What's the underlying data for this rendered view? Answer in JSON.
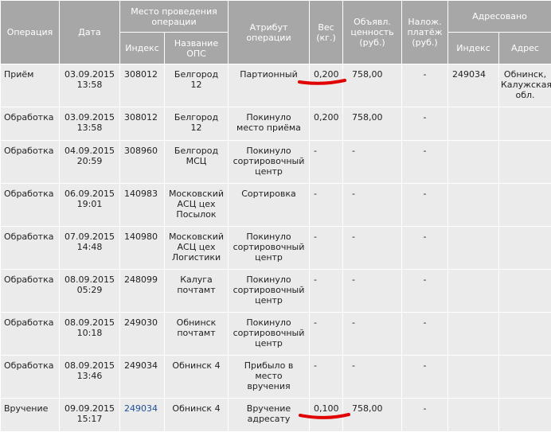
{
  "headers": {
    "operation": "Операция",
    "date": "Дата",
    "place_group": "Место проведения операции",
    "index": "Индекс",
    "ops_name": "Название ОПС",
    "attribute": "Атрибут операции",
    "weight": "Вес (кг.)",
    "declared": "Объявл. ценность (руб.)",
    "cod": "Налож. платёж (руб.)",
    "addressed": "Адресовано",
    "addr_index": "Индекс",
    "address": "Адрес"
  },
  "rows": [
    {
      "op": "Приём",
      "date": "03.09.2015\n13:58",
      "index": "308012",
      "name": "Белгород\n12",
      "attr": "Партионный",
      "weight": "0,200",
      "declared": "758,00",
      "cod": "-",
      "addr_index": "249034",
      "address": "Обнинск,\nКалужская\nобл."
    },
    {
      "op": "Обработка",
      "date": "03.09.2015\n13:58",
      "index": "308012",
      "name": "Белгород\n12",
      "attr": "Покинуло\nместо приёма",
      "weight": "0,200",
      "declared": "758,00",
      "cod": "-",
      "addr_index": "",
      "address": ""
    },
    {
      "op": "Обработка",
      "date": "04.09.2015\n20:59",
      "index": "308960",
      "name": "Белгород\nМСЦ",
      "attr": "Покинуло\nсортировочный\nцентр",
      "weight": "-",
      "declared": "-",
      "cod": "-",
      "addr_index": "",
      "address": ""
    },
    {
      "op": "Обработка",
      "date": "06.09.2015\n19:01",
      "index": "140983",
      "name": "Московский\nАСЦ цех\nПосылок",
      "attr": "Сортировка",
      "weight": "-",
      "declared": "-",
      "cod": "-",
      "addr_index": "",
      "address": ""
    },
    {
      "op": "Обработка",
      "date": "07.09.2015\n14:48",
      "index": "140980",
      "name": "Московский\nАСЦ цех\nЛогистики",
      "attr": "Покинуло\nсортировочный\nцентр",
      "weight": "-",
      "declared": "-",
      "cod": "-",
      "addr_index": "",
      "address": ""
    },
    {
      "op": "Обработка",
      "date": "08.09.2015\n05:29",
      "index": "248099",
      "name": "Калуга\nпочтамт",
      "attr": "Покинуло\nсортировочный\nцентр",
      "weight": "-",
      "declared": "-",
      "cod": "-",
      "addr_index": "",
      "address": ""
    },
    {
      "op": "Обработка",
      "date": "08.09.2015\n10:18",
      "index": "249030",
      "name": "Обнинск\nпочтамт",
      "attr": "Покинуло\nсортировочный\nцентр",
      "weight": "-",
      "declared": "-",
      "cod": "-",
      "addr_index": "",
      "address": ""
    },
    {
      "op": "Обработка",
      "date": "08.09.2015\n13:46",
      "index": "249034",
      "name": "Обнинск 4",
      "attr": "Прибыло в\nместо\nвручения",
      "weight": "-",
      "declared": "-",
      "cod": "-",
      "addr_index": "",
      "address": ""
    },
    {
      "op": "Вручение",
      "date": "09.09.2015\n15:17",
      "index": "249034",
      "index_is_link": true,
      "name": "Обнинск 4",
      "attr": "Вручение\nадресату",
      "weight": "0,100",
      "declared": "758,00",
      "cod": "-",
      "addr_index": "",
      "address": ""
    }
  ],
  "annotation_color": "#e00000"
}
